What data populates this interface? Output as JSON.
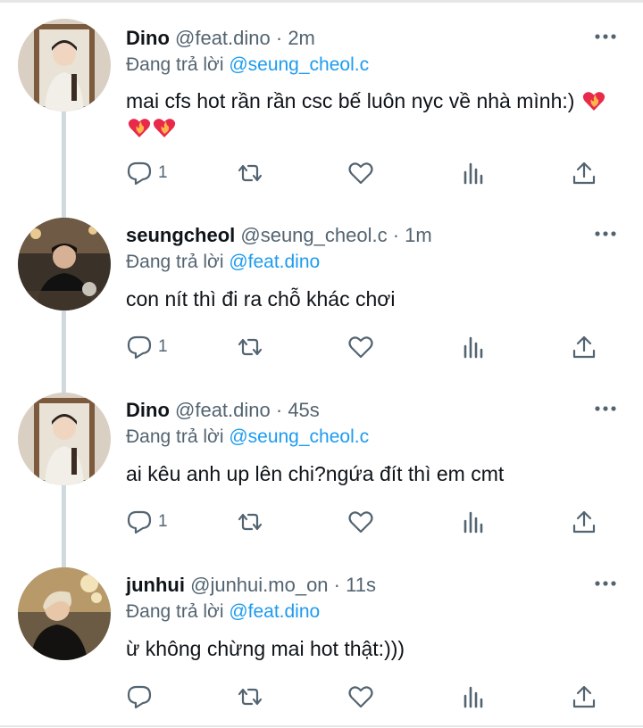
{
  "tweets": [
    {
      "name": "Dino",
      "handle": "@feat.dino",
      "time": "· 2m",
      "reply_prefix": "Đang trả lời",
      "reply_to": "@seung_cheol.c",
      "text": "mai cfs hot rần rần csc bế luôn nyc về nhà mình:)",
      "emoji": [
        "heart-on-fire",
        "heart-on-fire",
        "heart-on-fire"
      ],
      "reply_count": "1",
      "avatar": "avatar-dino"
    },
    {
      "name": "seungcheol",
      "handle": "@seung_cheol.c",
      "time": "· 1m",
      "reply_prefix": "Đang trả lời",
      "reply_to": "@feat.dino",
      "text": "con nít thì đi ra chỗ khác chơi",
      "emoji": [],
      "reply_count": "1",
      "avatar": "avatar-seungcheol"
    },
    {
      "name": "Dino",
      "handle": "@feat.dino",
      "time": "· 45s",
      "reply_prefix": "Đang trả lời",
      "reply_to": "@seung_cheol.c",
      "text": "ai kêu anh up lên chi?ngứa đít thì em cmt",
      "emoji": [],
      "reply_count": "1",
      "avatar": "avatar-dino"
    },
    {
      "name": "junhui",
      "handle": "@junhui.mo_on",
      "time": "· 11s",
      "reply_prefix": "Đang trả lời",
      "reply_to": "@feat.dino",
      "text": "ừ không chừng mai hot thật:)))",
      "emoji": [],
      "reply_count": "",
      "avatar": "avatar-junhui"
    }
  ],
  "icons": {
    "reply": "speech-bubble-icon",
    "retweet": "retweet-icon",
    "like": "heart-icon",
    "views": "bar-chart-icon",
    "share": "share-upload-icon",
    "more": "three-dots-icon"
  },
  "colors": {
    "link": "#1d9bf0",
    "secondary_text": "#536471",
    "thread_line": "#cfd9de",
    "emoji": "#e8294a"
  }
}
